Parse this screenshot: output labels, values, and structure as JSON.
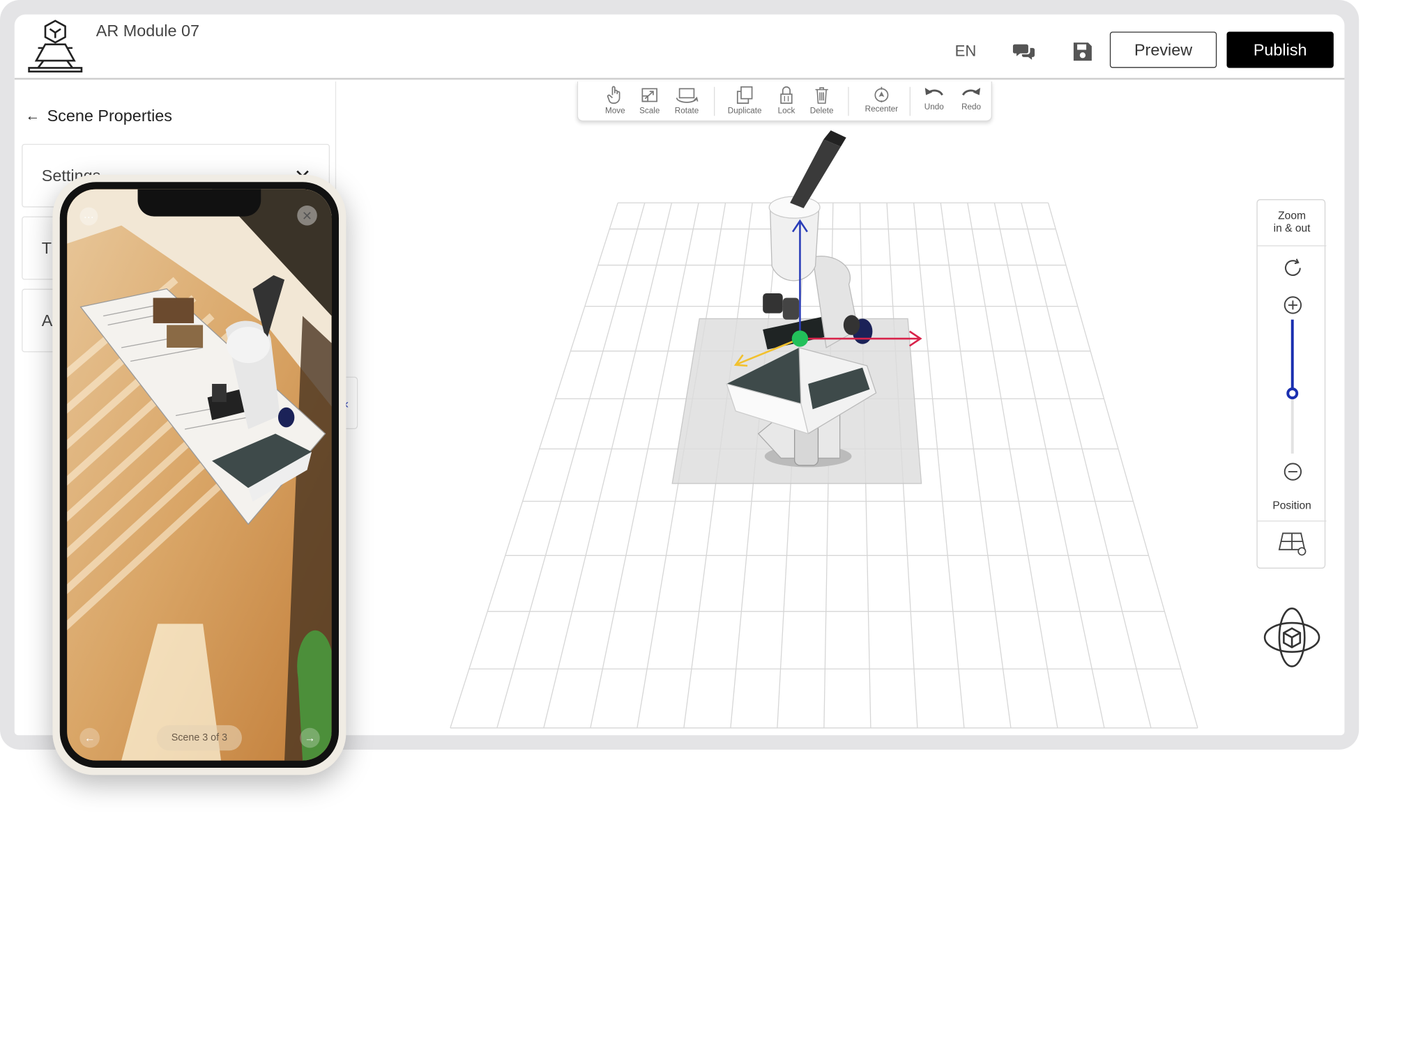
{
  "header": {
    "module_title": "AR Module 07",
    "language": "EN",
    "preview_label": "Preview",
    "publish_label": "Publish"
  },
  "sidebar": {
    "back_label": "Scene Properties",
    "panels": [
      {
        "label": "Settings"
      },
      {
        "label": "T"
      },
      {
        "label": "A"
      }
    ]
  },
  "toolbar": {
    "tools": [
      {
        "label": "Move",
        "icon": "hand-icon"
      },
      {
        "label": "Scale",
        "icon": "scale-icon"
      },
      {
        "label": "Rotate",
        "icon": "rotate-icon"
      },
      {
        "label": "Duplicate",
        "icon": "duplicate-icon"
      },
      {
        "label": "Lock",
        "icon": "lock-icon"
      },
      {
        "label": "Delete",
        "icon": "trash-icon"
      },
      {
        "label": "Recenter",
        "icon": "recenter-icon"
      },
      {
        "label": "Undo",
        "icon": "undo-icon"
      },
      {
        "label": "Redo",
        "icon": "redo-icon"
      }
    ]
  },
  "zoom_panel": {
    "title_line1": "Zoom",
    "title_line2": "in & out",
    "position_label": "Position",
    "zoom_level_fraction": 0.45
  },
  "phone": {
    "scene_label": "Scene 3 of 3"
  },
  "colors": {
    "accent_blue": "#1a2fb0",
    "publish_bg": "#000000",
    "gizmo_x": "#d8234a",
    "gizmo_y": "#2a3db8",
    "gizmo_z": "#f2c12e",
    "gizmo_center": "#22c05a"
  }
}
